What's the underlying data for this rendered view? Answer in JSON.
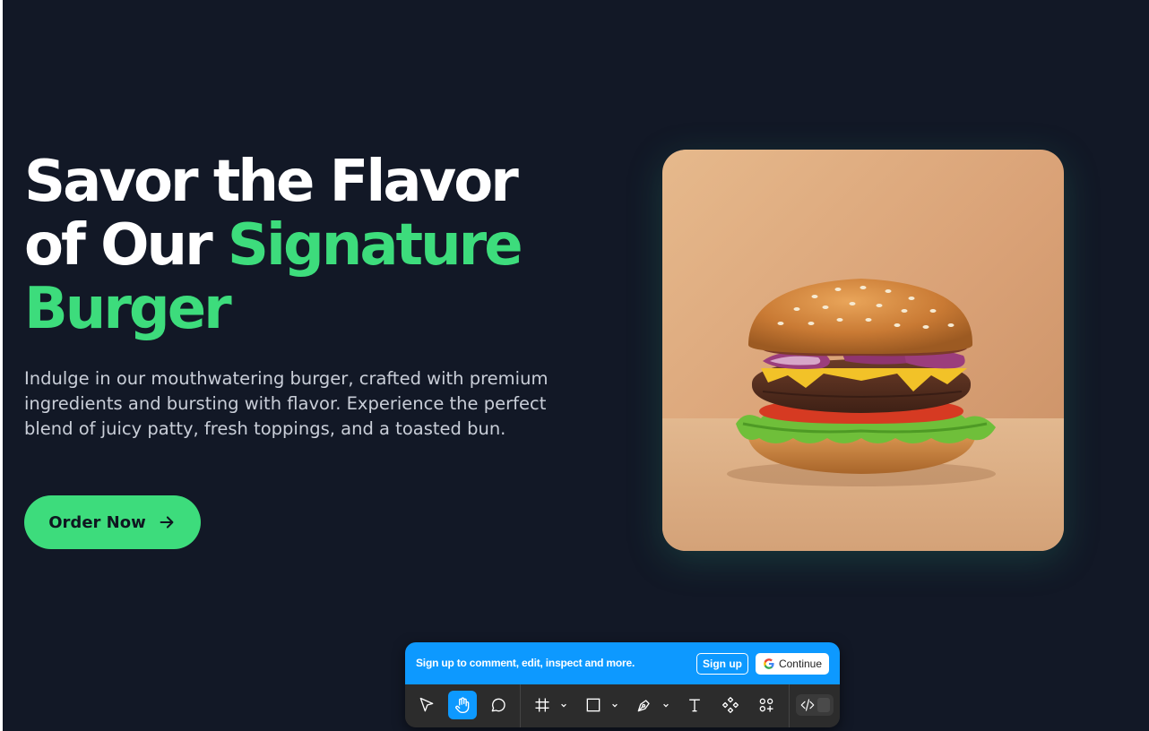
{
  "hero": {
    "title_line1": "Savor the Flavor",
    "title_line2_plain": "of Our ",
    "title_line2_accent": "Signature",
    "title_line3_accent": "Burger",
    "description": "Indulge in our mouthwatering burger, crafted with premium ingredients and bursting with flavor. Experience the perfect blend of juicy patty, fresh toppings, and a toasted bun.",
    "cta_label": "Order Now",
    "image_subject": "burger-photo"
  },
  "colors": {
    "background": "#121826",
    "accent": "#3ddc7c",
    "text": "#ffffff",
    "muted_text": "#c9ced8",
    "toolbar_blue": "#0d99ff"
  },
  "toolbar": {
    "signup_prompt": "Sign up to comment, edit, inspect and more.",
    "signup_label": "Sign up",
    "continue_label": "Continue",
    "tools": [
      {
        "icon": "move-arrow-icon",
        "active": false
      },
      {
        "icon": "hand-icon",
        "active": true
      },
      {
        "icon": "comment-icon",
        "active": false
      },
      {
        "icon": "frame-icon",
        "active": false
      },
      {
        "icon": "rectangle-icon",
        "active": false
      },
      {
        "icon": "pen-icon",
        "active": false
      },
      {
        "icon": "text-icon",
        "active": false
      },
      {
        "icon": "component-icon",
        "active": false
      },
      {
        "icon": "plugins-icon",
        "active": false
      },
      {
        "icon": "dev-mode-icon",
        "active": false
      }
    ]
  }
}
